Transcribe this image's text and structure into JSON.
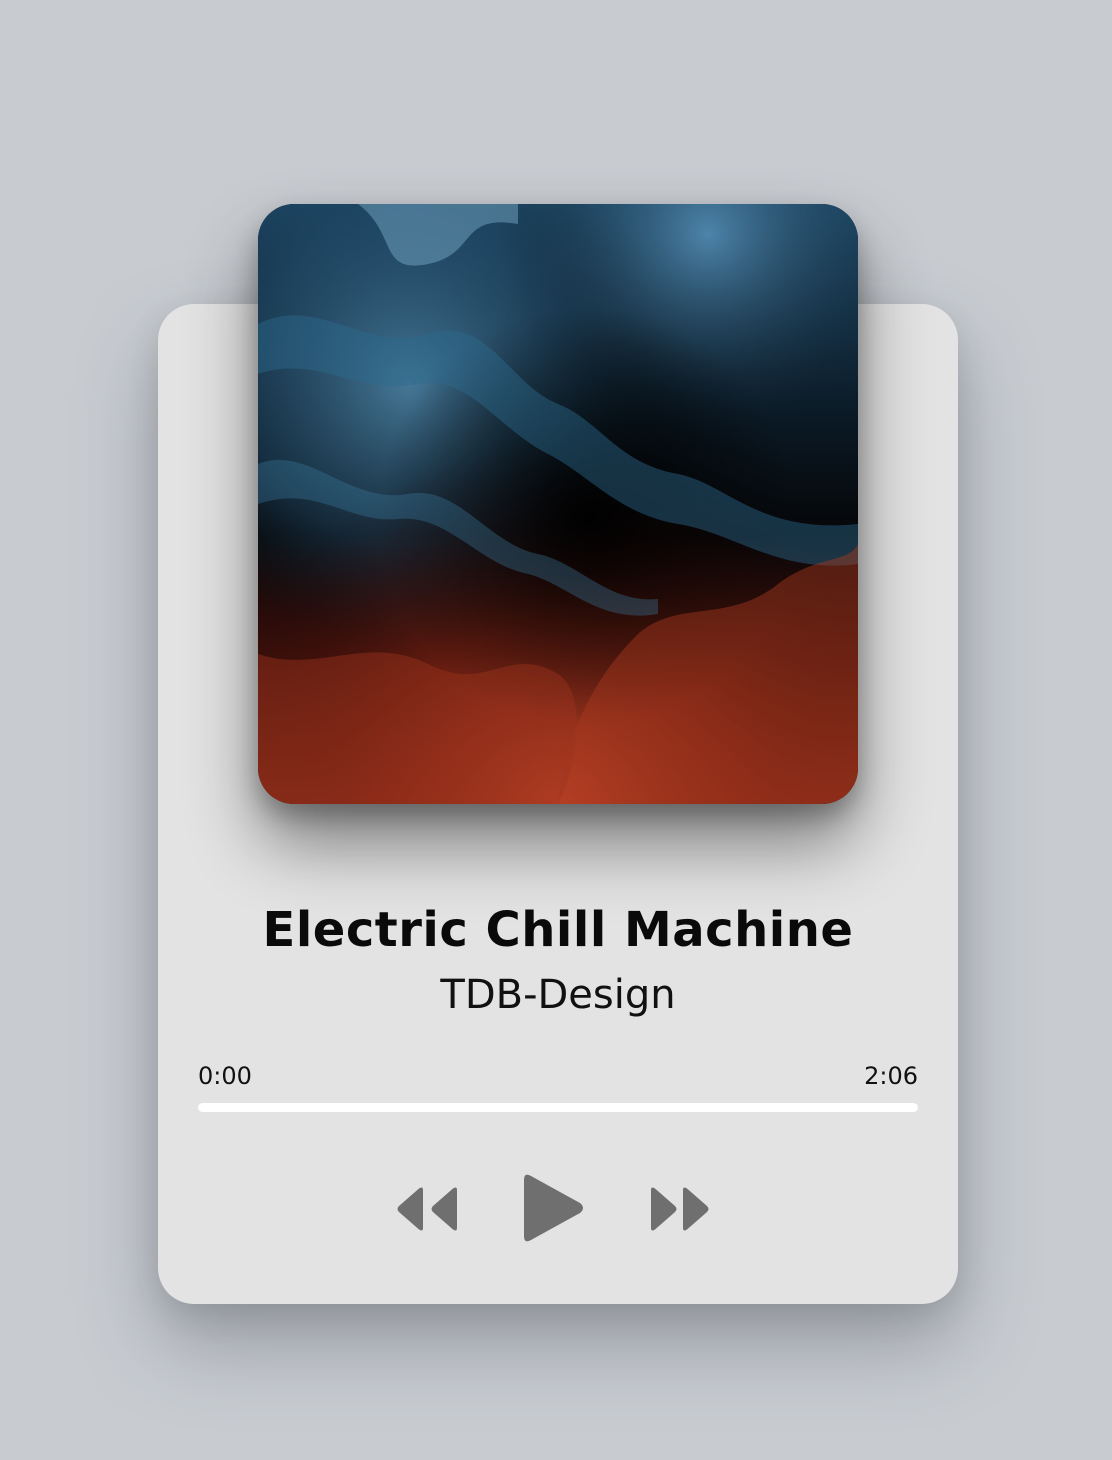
{
  "track": {
    "title": "Electric Chill Machine",
    "artist": "TDB-Design"
  },
  "playback": {
    "current_time": "0:00",
    "total_time": "2:06",
    "progress": 0
  },
  "controls": {
    "previous_icon": "rewind-icon",
    "play_icon": "play-icon",
    "next_icon": "fast-forward-icon"
  },
  "colors": {
    "background": "#c8ccd1",
    "card": "#e3e3e3",
    "icon": "#6f6f6f",
    "progress_track": "#ffffff"
  }
}
